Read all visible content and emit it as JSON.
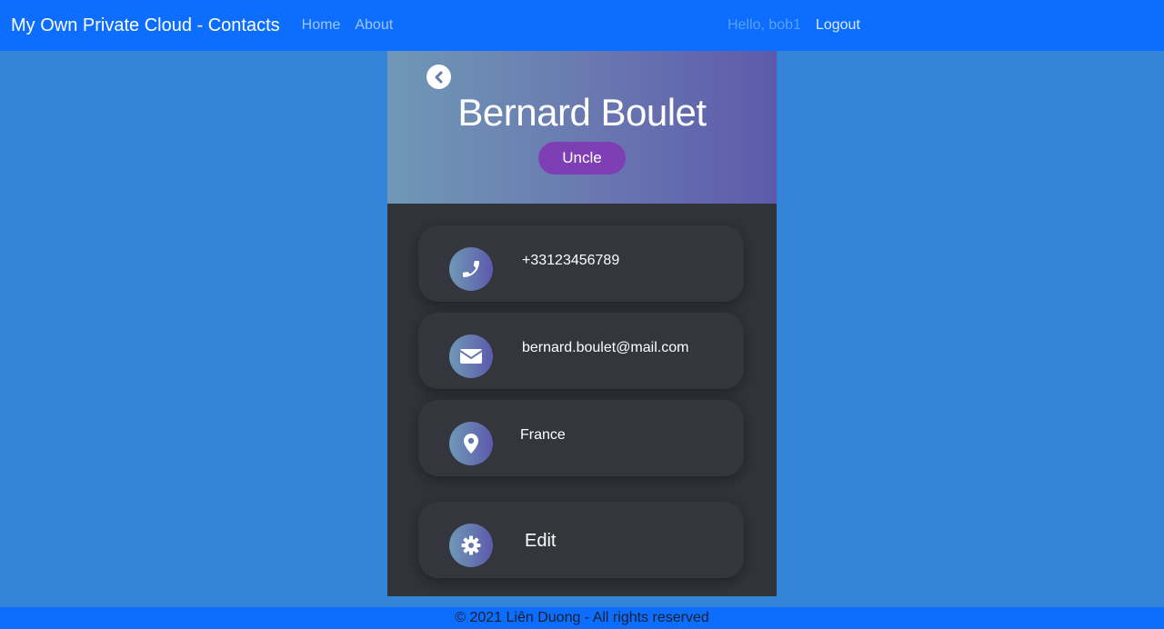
{
  "navbar": {
    "brand": "My Own Private Cloud - Contacts",
    "links": [
      {
        "label": "Home"
      },
      {
        "label": "About"
      }
    ],
    "greeting": "Hello, bob1",
    "logout_label": "Logout"
  },
  "contact": {
    "name": "Bernard Boulet",
    "relation": "Uncle",
    "phone": "+33123456789",
    "email": "bernard.boulet@mail.com",
    "location": "France",
    "edit_label": "Edit"
  },
  "icons": {
    "back": "chevron-left-circle-icon",
    "phone": "phone-icon",
    "email": "envelope-icon",
    "location": "map-marker-icon",
    "edit": "gear-icon"
  },
  "colors": {
    "navbar": "#0d6efd",
    "page_background": "#3485da",
    "card_body": "#31343a",
    "badge": "#7e3fb4",
    "gradient_start": "#6f98b6",
    "gradient_end": "#5d5aac"
  },
  "footer": {
    "text": "© 2021 Liên Duong - All rights reserved"
  }
}
